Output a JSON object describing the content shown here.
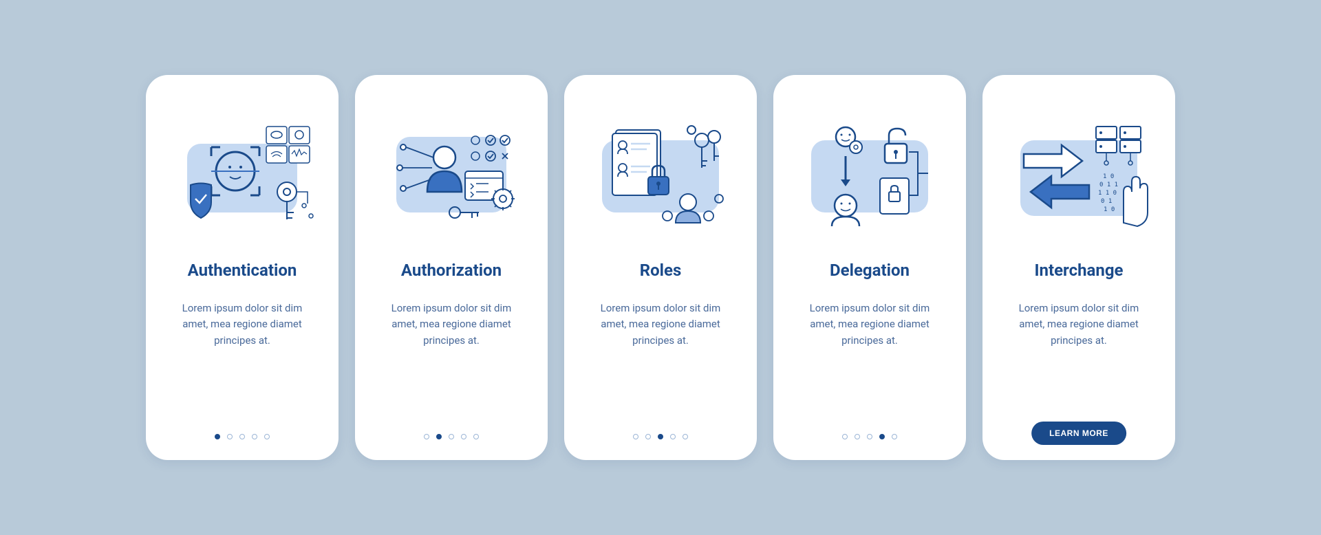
{
  "cards": [
    {
      "title": "Authentication",
      "body": "Lorem ipsum dolor sit dim amet, mea regione diamet principes at.",
      "active_dot": 0,
      "has_button": false
    },
    {
      "title": "Authorization",
      "body": "Lorem ipsum dolor sit dim amet, mea regione diamet principes at.",
      "active_dot": 1,
      "has_button": false
    },
    {
      "title": "Roles",
      "body": "Lorem ipsum dolor sit dim amet, mea regione diamet principes at.",
      "active_dot": 2,
      "has_button": false
    },
    {
      "title": "Delegation",
      "body": "Lorem ipsum dolor sit dim amet, mea regione diamet principes at.",
      "active_dot": 3,
      "has_button": false
    },
    {
      "title": "Interchange",
      "body": "Lorem ipsum dolor sit dim amet, mea regione diamet principes at.",
      "active_dot": 4,
      "has_button": true
    }
  ],
  "button_label": "LEARN MORE",
  "colors": {
    "primary": "#1a4a8a",
    "light": "#c5d9f2",
    "medium": "#8fb0e0",
    "accent": "#3970c0"
  }
}
